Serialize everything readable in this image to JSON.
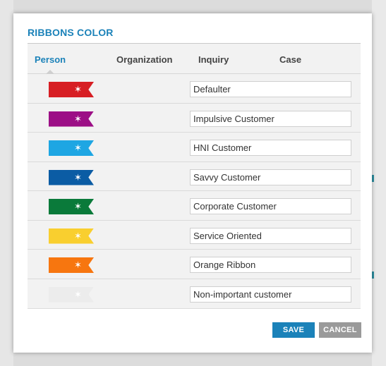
{
  "dialog": {
    "title": "RIBBONS COLOR",
    "tabs": [
      {
        "label": "Person",
        "active": true
      },
      {
        "label": "Organization",
        "active": false
      },
      {
        "label": "Inquiry",
        "active": false
      },
      {
        "label": "Case",
        "active": false
      }
    ],
    "ribbons": [
      {
        "color": "#d71f24",
        "name": "Defaulter"
      },
      {
        "color": "#9c0f86",
        "name": "Impulsive Customer"
      },
      {
        "color": "#1ea6e3",
        "name": "HNI Customer"
      },
      {
        "color": "#0b5ca4",
        "name": "Savvy Customer"
      },
      {
        "color": "#0a7a3a",
        "name": "Corporate Customer"
      },
      {
        "color": "#f9cf2f",
        "name": "Service Oriented"
      },
      {
        "color": "#f7760f",
        "name": "Orange Ribbon"
      },
      {
        "color": "#ececec",
        "name": "Non-important customer"
      }
    ],
    "ribbon_icon": "star-icon",
    "buttons": {
      "save": "SAVE",
      "cancel": "CANCEL"
    }
  },
  "colors": {
    "accent": "#1b82b9",
    "cancel": "#9a9a9a"
  }
}
